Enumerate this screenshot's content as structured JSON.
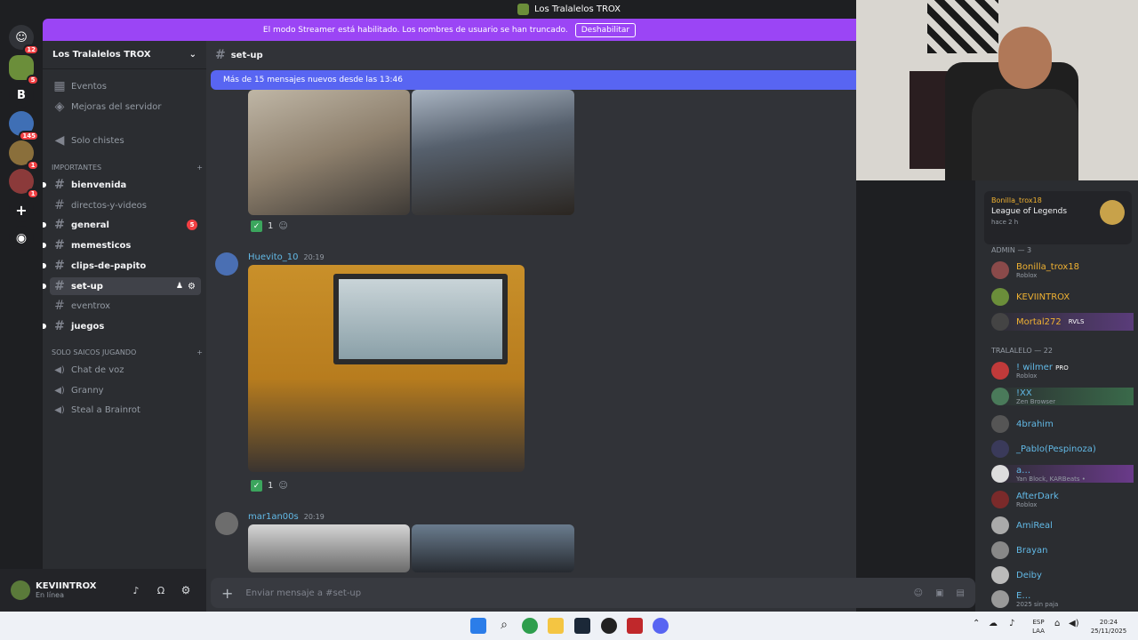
{
  "window": {
    "title": "Los Tralalelos TROX"
  },
  "banner": {
    "text": "El modo Streamer está habilitado. Los nombres de usuario se han truncado.",
    "button": "Deshabilitar"
  },
  "guilds": [
    {
      "label": "",
      "badge": "12",
      "color": "#313338"
    },
    {
      "label": "",
      "badge": "5",
      "color": "#6b8e3a"
    },
    {
      "label": "B",
      "badge": "",
      "color": "#1e1f22"
    },
    {
      "label": "",
      "badge": "145",
      "color": "#3f6fb5"
    },
    {
      "label": "",
      "badge": "1",
      "color": "#8a6f3b"
    },
    {
      "label": "",
      "badge": "1",
      "color": "#8b3a3a"
    }
  ],
  "server": {
    "name": "Los Tralalelos TROX"
  },
  "sidebar": {
    "top": [
      "Eventos",
      "Mejoras del servidor",
      "Solo chistes"
    ],
    "cat1": "IMPORTANTES",
    "channels": [
      {
        "name": "bienvenida",
        "unread": true
      },
      {
        "name": "directos-y-videos",
        "unread": false
      },
      {
        "name": "general",
        "unread": true,
        "badge": "5"
      },
      {
        "name": "memesticos",
        "unread": true
      },
      {
        "name": "clips-de-papito",
        "unread": true
      },
      {
        "name": "set-up",
        "unread": true
      },
      {
        "name": "eventrox",
        "unread": false
      },
      {
        "name": "juegos",
        "unread": true
      }
    ],
    "cat2": "SOLO SAICOS JUGANDO",
    "voice": [
      "Chat de voz",
      "Granny",
      "Steal a Brainrot"
    ]
  },
  "user": {
    "name": "KEVIINTROX",
    "status": "En línea"
  },
  "channel": {
    "name": "set-up",
    "newbar": "Más de 15 mensajes nuevos desde las 13:46",
    "input_placeholder": "Enviar mensaje a #set-up"
  },
  "messages": [
    {
      "reaction": "1"
    },
    {
      "author": "Huevito_10",
      "time": "20:19",
      "reaction": "1"
    },
    {
      "author": "mar1an00s",
      "time": "20:19"
    }
  ],
  "members": {
    "activity": {
      "user": "Bonilla_trox18",
      "game": "League of Legends",
      "ago": "hace 2 h"
    },
    "admin_cat": "ADMIN",
    "admin_count": "— 3",
    "admins": [
      {
        "name": "Bonilla_trox18",
        "sub": "Roblox",
        "color": "#f0b232"
      },
      {
        "name": "KEVIINTROX",
        "sub": "",
        "color": "#f0b232"
      },
      {
        "name": "Mortal272",
        "sub": "",
        "color": "#f0b232",
        "tag": "RVLS"
      }
    ],
    "tral_cat": "TRALALELO",
    "tral_count": "— 22",
    "tral": [
      {
        "name": "! wilmer",
        "sub": "Roblox",
        "tag": "PRO"
      },
      {
        "name": "!XX",
        "sub": "Zen Browser"
      },
      {
        "name": "4brahim",
        "sub": ""
      },
      {
        "name": "_Pablo(Pespinoza)",
        "sub": ""
      },
      {
        "name": "a…",
        "sub": "Yan Block, KARBeats •"
      },
      {
        "name": "AfterDark",
        "sub": "Roblox"
      },
      {
        "name": "AmiReal",
        "sub": ""
      },
      {
        "name": "Brayan",
        "sub": ""
      },
      {
        "name": "Deiby",
        "sub": ""
      },
      {
        "name": "E…",
        "sub": "2025 sin paja"
      }
    ]
  },
  "taskbar": {
    "lang1": "ESP",
    "lang2": "LAA",
    "time": "20:24",
    "date": "25/11/2025"
  }
}
